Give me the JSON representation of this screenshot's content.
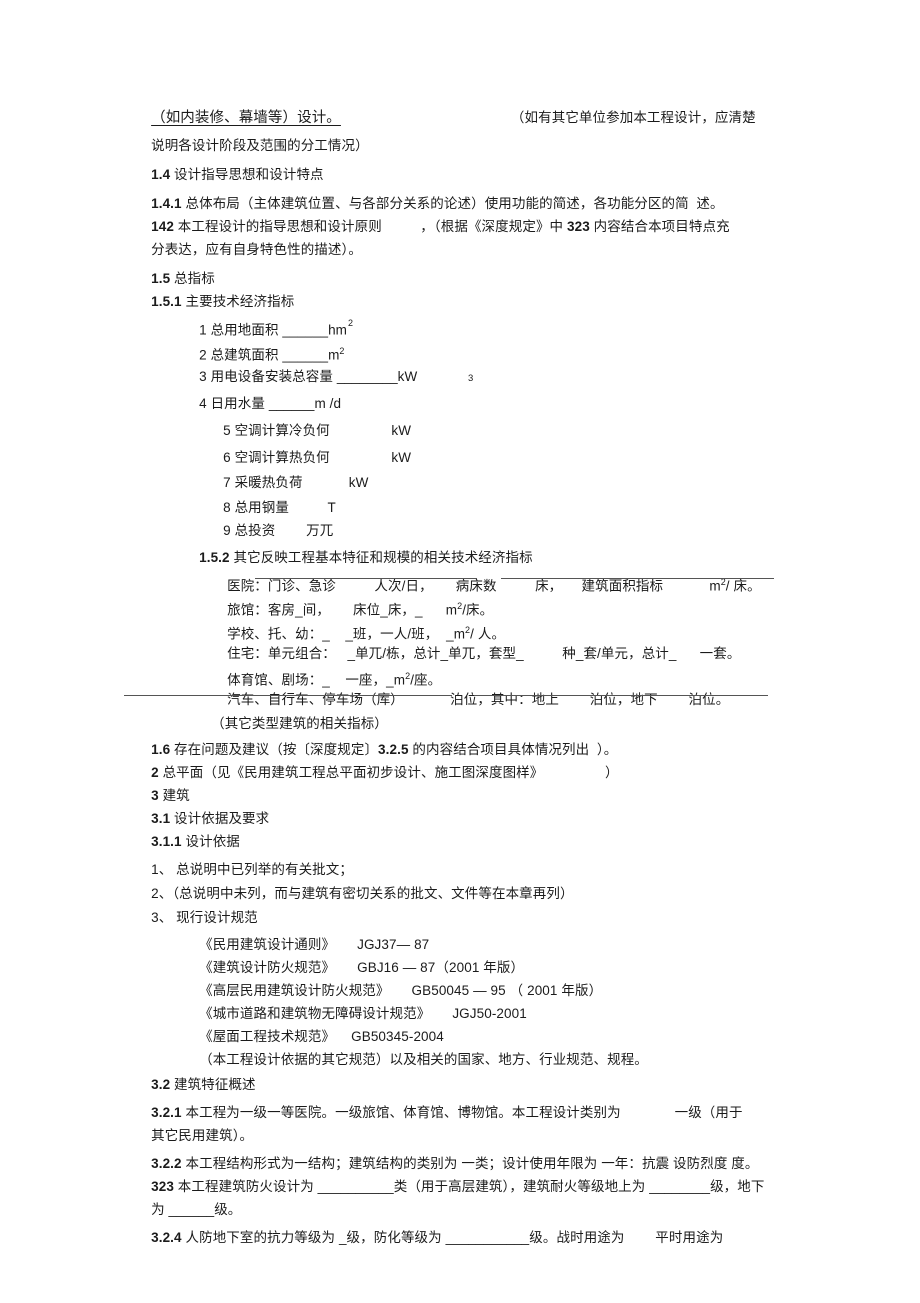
{
  "document": {
    "language": "zh-CN",
    "lines": {
      "l1_left": "（如内装修、幕墙等）设计。",
      "l1_right": "（如有其它单位参加本工程设计，应清楚",
      "l2": "说明各设计阶段及范围的分工情况）",
      "s14_num": "1.4",
      "s14_text": " 设计指导思想和设计特点",
      "s141_num": "1.4.1",
      "s141_text": " 总体布局（主体建筑位置、与各部分关系的论述）使用功能的简述，各功能分区的简  述。",
      "s142_num": "142",
      "s142_text": " 本工程设计的指导思想和设计原则          ，（根据《深度规定》中 ",
      "s142_num2": "323",
      "s142_text2": " 内容结合本项目特点充",
      "s142_cont": "分表达，应有自身特色性的描述）。",
      "s15_num": "1.5",
      "s15_text": " 总指标",
      "s151_num": "1.5.1",
      "s151_text": " 主要技术经济指标",
      "item1": "1 总用地面积 ______hm",
      "item1_sup": "2",
      "item2": "2 总建筑面积 ______m",
      "item2_sup": "2",
      "item3": "3 用电设备安装总容量 ________kW",
      "item4": "4 日用水量 ______m /d",
      "item4_float": "3",
      "item5": "5 空调计算冷负何                kW",
      "item6": "6 空调计算热负何                kW",
      "item7": "7 采暖热负荷            kW",
      "item8": "8 总用钢量          T",
      "item9": "9 总投资        万兀",
      "s152_num": "1.5.2",
      "s152_text": " 其它反映工程基本特征和规模的相关技术经济指标",
      "row_hospital": "医院：门诊、急诊          人次/日，      病床数          床，     建筑面积指标            m",
      "row_hospital_sup": "2",
      "row_hospital_tail": "/ 床。",
      "row_hotel": "旅馆：客房_间，      床位_床，_      m",
      "row_hotel_sup": "2",
      "row_hotel_tail": "/床。",
      "row_school": "学校、托、幼：_    _班，一人/班，  _m",
      "row_school_sup": "2",
      "row_school_tail": "/ 人。",
      "row_residence": "住宅：单元组合：   _单兀/栋，总计_单兀，套型_          种_套/单元，总计_      一套。",
      "row_stadium": "体育馆、剧场：_    一座，_m",
      "row_stadium_sup": "2",
      "row_stadium_tail": "/座。",
      "row_parking": "汽车、自行车、停车场（库）            泊位，其中：地上        泊位，地下        泊位。",
      "row_other": "（其它类型建筑的相关指标）",
      "s16_num": "1.6",
      "s16_text": " 存在问题及建议（按〔深度规定〕",
      "s16_num2": "3.2.5",
      "s16_text2": " 的内容结合项目具体情况列出  ）。",
      "s2_num": "2",
      "s2_text": " 总平面（见《民用建筑工程总平面初步设计、施工图深度图样》                ）",
      "s3_num": "3",
      "s3_text": " 建筑",
      "s31_num": "3.1",
      "s31_text": " 设计依据及要求",
      "s311_num": "3.1.1",
      "s311_text": " 设计依据",
      "basis1": "1、 总说明中已列举的有关批文；",
      "basis2": "2、（总说明中未列，而与建筑有密切关系的批文、文件等在本章再列）",
      "basis3": "3、 现行设计规范",
      "std1_name": "《民用建筑设计通则》",
      "std1_code": "JGJ37— 87",
      "std2_name": "《建筑设计防火规范》",
      "std2_code": "GBJ16 — 87（2001 年版）",
      "std3_name": "《高层民用建筑设计防火规范》",
      "std3_code": "GB50045 — 95 （ 2001 年版）",
      "std4_name": "《城市道路和建筑物无障碍设计规范》",
      "std4_code": "JGJ50-2001",
      "std5_name": "《屋面工程技术规范》",
      "std5_code": "GB50345-2004",
      "std_note": "（本工程设计依据的其它规范）以及相关的国家、地方、行业规范、规程。",
      "s32_num": "3.2",
      "s32_text": " 建筑特征概述",
      "s321_num": "3.2.1",
      "s321_text": " 本工程为一级一等医院。一级旅馆、体育馆、博物馆。本工程设计类别为              一级（用于",
      "s321_cont": "其它民用建筑）。",
      "s322_num": "3.2.2",
      "s322_text": " 本工程结构形式为一结构；建筑结构的类别为 一类；设计使用年限为 一年：抗震 设防烈度 度。",
      "s323_num": "323",
      "s323_text": " 本工程建筑防火设计为 __________类（用于高层建筑），建筑耐火等级地上为 ________级，地下",
      "s323_cont": "为 ______级。",
      "s324_num": "3.2.4",
      "s324_text": " 人防地下室的抗力等级为 _级，防化等级为 ___________级。战时用途为        平时用途为"
    }
  }
}
